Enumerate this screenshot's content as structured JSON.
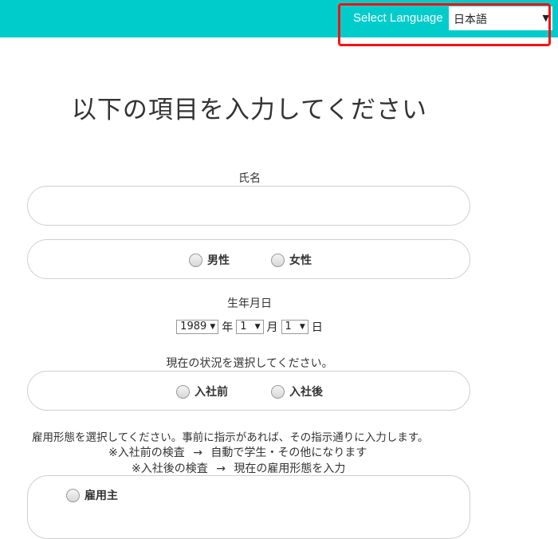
{
  "header": {
    "language_label": "Select Language",
    "language_value": "日本語"
  },
  "title": "以下の項目を入力してください",
  "name_field": {
    "label": "氏名",
    "value": ""
  },
  "gender": {
    "options": [
      "男性",
      "女性"
    ]
  },
  "dob": {
    "label": "生年月日",
    "year": "1989",
    "year_unit": "年",
    "month": "1",
    "month_unit": "月",
    "day": "1",
    "day_unit": "日"
  },
  "status": {
    "label": "現在の状況を選択してください。",
    "options": [
      "入社前",
      "入社後"
    ]
  },
  "employment": {
    "instruction": "雇用形態を選択してください。事前に指示があれば、その指示通りに入力します。",
    "note1_prefix": "※入社前の検査",
    "note1_arrow": "→",
    "note1_text": "自動で学生・その他になります",
    "note2_prefix": "※入社後の検査",
    "note2_arrow": "→",
    "note2_text": "現在の雇用形態を入力",
    "options": [
      "雇用主"
    ]
  }
}
